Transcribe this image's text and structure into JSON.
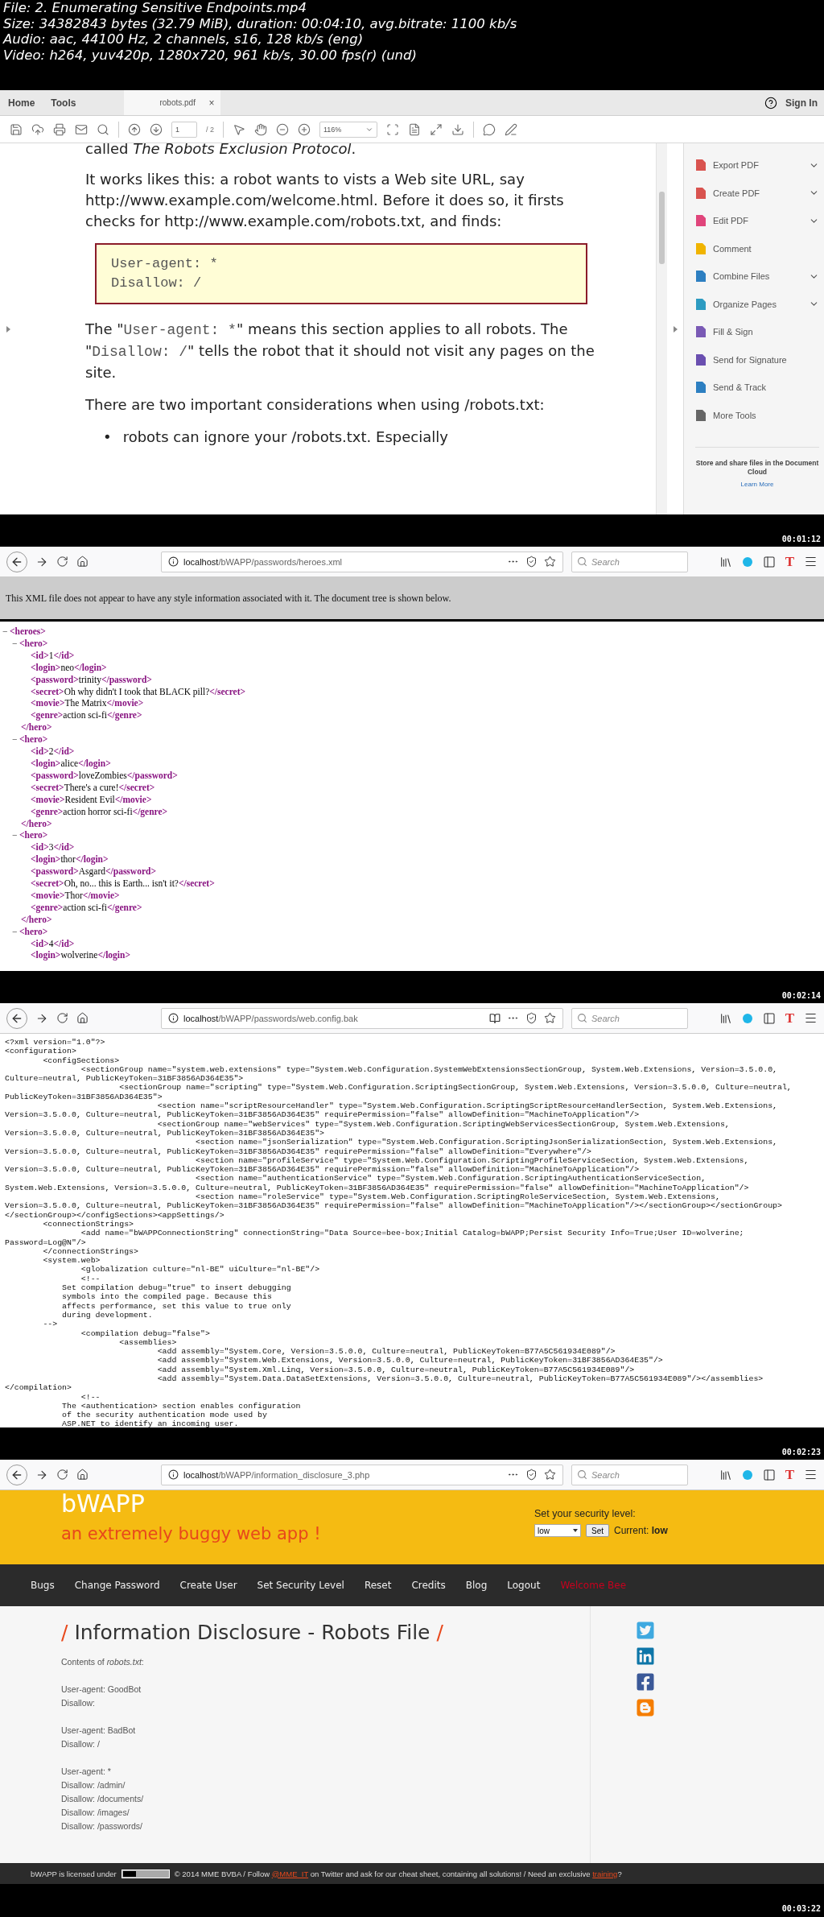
{
  "file_info": [
    "File: 2. Enumerating Sensitive Endpoints.mp4",
    "Size: 34382843 bytes (32.79 MiB), duration: 00:04:10, avg.bitrate: 1100 kb/s",
    "Audio: aac, 44100 Hz, 2 channels, s16, 128 kb/s (eng)",
    "Video: h264, yuv420p, 1280x720, 961 kb/s, 30.00 fps(r) (und)"
  ],
  "frames": [
    {
      "kind": "pdf",
      "timestamp": "00:01:12",
      "menu_tabs": [
        "Home",
        "Tools"
      ],
      "doc_tab": "robots.pdf",
      "close": "×",
      "sign_in": "Sign In",
      "page": "1",
      "page_total": "/ 2",
      "zoom": "116%",
      "top_line": "called *The Robots Exclusion Protocol*.",
      "intro": "It works likes this: a robot wants to vists a Web site URL, say http://www.example.com/welcome.html. Before it does so, it firsts checks for http://www.example.com/robots.txt, and finds:",
      "code_lines": [
        "User-agent: *",
        "Disallow: /"
      ],
      "explain": [
        {
          "kind": "text",
          "text": "The \""
        },
        {
          "kind": "code",
          "text": "User-agent: *"
        },
        {
          "kind": "text",
          "text": "\" means this section applies to all robots. The \""
        },
        {
          "kind": "code",
          "text": "Disallow: /"
        },
        {
          "kind": "text",
          "text": "\" tells the robot that it should not visit any pages on the site."
        }
      ],
      "considerations": "There are two important considerations when using /robots.txt:",
      "bullet": {
        "mark": "•",
        "text": "robots can ignore your /robots.txt. Especially"
      },
      "tools": [
        {
          "label": "Export PDF",
          "has_menu": true,
          "color": "#d9534f"
        },
        {
          "label": "Create PDF",
          "has_menu": true,
          "color": "#d9534f"
        },
        {
          "label": "Edit PDF",
          "has_menu": true,
          "color": "#e0457b"
        },
        {
          "label": "Comment",
          "has_menu": false,
          "color": "#f0b400"
        },
        {
          "label": "Combine Files",
          "has_menu": true,
          "color": "#2d7fc1"
        },
        {
          "label": "Organize Pages",
          "has_menu": true,
          "color": "#2d9bc1"
        },
        {
          "label": "Fill & Sign",
          "has_menu": false,
          "color": "#7a5ab5"
        },
        {
          "label": "Send for Signature",
          "has_menu": false,
          "color": "#6a4fb0"
        },
        {
          "label": "Send & Track",
          "has_menu": false,
          "color": "#2d7fc1"
        },
        {
          "label": "More Tools",
          "has_menu": false,
          "color": "#666666"
        }
      ],
      "cloud_text": "Store and share files in the Document Cloud",
      "learn_more": "Learn More"
    },
    {
      "kind": "xml",
      "timestamp": "00:02:14",
      "browser": {
        "url_host": "localhost",
        "url_path": "/bWAPP/passwords/heroes.xml",
        "search_placeholder": "Search",
        "reader_view": false,
        "extension_letter": "T"
      },
      "notice": "This XML file does not appear to have any style information associated with it. The document tree is shown below.",
      "tree": {
        "toggle": "−",
        "open": "<heroes>",
        "children": [
          {
            "toggle": "−",
            "open": "<hero>",
            "close": "</hero>",
            "fields": [
              {
                "open": "<id>",
                "value": "1",
                "close": "</id>"
              },
              {
                "open": "<login>",
                "value": "neo",
                "close": "</login>"
              },
              {
                "open": "<password>",
                "value": "trinity",
                "close": "</password>"
              },
              {
                "open": "<secret>",
                "value": "Oh why didn't I took that BLACK pill?",
                "close": "</secret>"
              },
              {
                "open": "<movie>",
                "value": "The Matrix",
                "close": "</movie>"
              },
              {
                "open": "<genre>",
                "value": "action sci-fi",
                "close": "</genre>"
              }
            ]
          },
          {
            "toggle": "−",
            "open": "<hero>",
            "close": "</hero>",
            "fields": [
              {
                "open": "<id>",
                "value": "2",
                "close": "</id>"
              },
              {
                "open": "<login>",
                "value": "alice",
                "close": "</login>"
              },
              {
                "open": "<password>",
                "value": "loveZombies",
                "close": "</password>"
              },
              {
                "open": "<secret>",
                "value": "There's a cure!",
                "close": "</secret>"
              },
              {
                "open": "<movie>",
                "value": "Resident Evil",
                "close": "</movie>"
              },
              {
                "open": "<genre>",
                "value": "action horror sci-fi",
                "close": "</genre>"
              }
            ]
          },
          {
            "toggle": "−",
            "open": "<hero>",
            "close": "</hero>",
            "fields": [
              {
                "open": "<id>",
                "value": "3",
                "close": "</id>"
              },
              {
                "open": "<login>",
                "value": "thor",
                "close": "</login>"
              },
              {
                "open": "<password>",
                "value": "Asgard",
                "close": "</password>"
              },
              {
                "open": "<secret>",
                "value": "Oh, no... this is Earth... isn't it?",
                "close": "</secret>"
              },
              {
                "open": "<movie>",
                "value": "Thor",
                "close": "</movie>"
              },
              {
                "open": "<genre>",
                "value": "action sci-fi",
                "close": "</genre>"
              }
            ]
          },
          {
            "toggle": "−",
            "open": "<hero>",
            "fields": [
              {
                "open": "<id>",
                "value": "4",
                "close": "</id>"
              },
              {
                "open": "<login>",
                "value": "wolverine",
                "close": "</login>"
              }
            ]
          }
        ]
      }
    },
    {
      "kind": "source",
      "timestamp": "00:02:23",
      "browser": {
        "url_host": "localhost",
        "url_path": "/bWAPP/passwords/web.config.bak",
        "search_placeholder": "Search",
        "reader_view": true,
        "extension_letter": "T"
      },
      "lines": [
        "<?xml version=\"1.0\"?>",
        "<configuration>",
        "        <configSections>",
        "                <sectionGroup name=\"system.web.extensions\" type=\"System.Web.Configuration.SystemWebExtensionsSectionGroup, System.Web.Extensions, Version=3.5.0.0,",
        "Culture=neutral, PublicKeyToken=31BF3856AD364E35\">",
        "                        <sectionGroup name=\"scripting\" type=\"System.Web.Configuration.ScriptingSectionGroup, System.Web.Extensions, Version=3.5.0.0, Culture=neutral,",
        "PublicKeyToken=31BF3856AD364E35\">",
        "                                <section name=\"scriptResourceHandler\" type=\"System.Web.Configuration.ScriptingScriptResourceHandlerSection, System.Web.Extensions,",
        "Version=3.5.0.0, Culture=neutral, PublicKeyToken=31BF3856AD364E35\" requirePermission=\"false\" allowDefinition=\"MachineToApplication\"/>",
        "                                <sectionGroup name=\"webServices\" type=\"System.Web.Configuration.ScriptingWebServicesSectionGroup, System.Web.Extensions,",
        "Version=3.5.0.0, Culture=neutral, PublicKeyToken=31BF3856AD364E35\">",
        "                                        <section name=\"jsonSerialization\" type=\"System.Web.Configuration.ScriptingJsonSerializationSection, System.Web.Extensions,",
        "Version=3.5.0.0, Culture=neutral, PublicKeyToken=31BF3856AD364E35\" requirePermission=\"false\" allowDefinition=\"Everywhere\"/>",
        "                                        <section name=\"profileService\" type=\"System.Web.Configuration.ScriptingProfileServiceSection, System.Web.Extensions,",
        "Version=3.5.0.0, Culture=neutral, PublicKeyToken=31BF3856AD364E35\" requirePermission=\"false\" allowDefinition=\"MachineToApplication\"/>",
        "                                        <section name=\"authenticationService\" type=\"System.Web.Configuration.ScriptingAuthenticationServiceSection,",
        "System.Web.Extensions, Version=3.5.0.0, Culture=neutral, PublicKeyToken=31BF3856AD364E35\" requirePermission=\"false\" allowDefinition=\"MachineToApplication\"/>",
        "                                        <section name=\"roleService\" type=\"System.Web.Configuration.ScriptingRoleServiceSection, System.Web.Extensions,",
        "Version=3.5.0.0, Culture=neutral, PublicKeyToken=31BF3856AD364E35\" requirePermission=\"false\" allowDefinition=\"MachineToApplication\"/></sectionGroup></sectionGroup>",
        "</sectionGroup></configSections><appSettings/>",
        "        <connectionStrings>",
        "                <add name=\"bWAPPConnectionString\" connectionString=\"Data Source=bee-box;Initial Catalog=bWAPP;Persist Security Info=True;User ID=wolverine;",
        "Password=Log@N\"/>",
        "        </connectionStrings>",
        "        <system.web>",
        "                <globalization culture=\"nl-BE\" uiCulture=\"nl-BE\"/>",
        "                <!--",
        "            Set compilation debug=\"true\" to insert debugging",
        "            symbols into the compiled page. Because this",
        "            affects performance, set this value to true only",
        "            during development.",
        "        -->",
        "                <compilation debug=\"false\">",
        "                        <assemblies>",
        "                                <add assembly=\"System.Core, Version=3.5.0.0, Culture=neutral, PublicKeyToken=B77A5C561934E089\"/>",
        "                                <add assembly=\"System.Web.Extensions, Version=3.5.0.0, Culture=neutral, PublicKeyToken=31BF3856AD364E35\"/>",
        "                                <add assembly=\"System.Xml.Linq, Version=3.5.0.0, Culture=neutral, PublicKeyToken=B77A5C561934E089\"/>",
        "                                <add assembly=\"System.Data.DataSetExtensions, Version=3.5.0.0, Culture=neutral, PublicKeyToken=B77A5C561934E089\"/></assemblies>",
        "</compilation>",
        "                <!--",
        "            The <authentication> section enables configuration",
        "            of the security authentication mode used by",
        "            ASP.NET to identify an incoming user."
      ]
    },
    {
      "kind": "bwapp",
      "timestamp": "00:03:22",
      "browser": {
        "url_host": "localhost",
        "url_path": "/bWAPP/information_disclosure_3.php",
        "search_placeholder": "Search",
        "reader_view": false,
        "extension_letter": "T"
      },
      "logo": "bWAPP",
      "tagline": "an extremely buggy web app !",
      "security": {
        "label": "Set your security level:",
        "select_value": "low",
        "button": "Set",
        "current_label": "Current:",
        "current_value": "low"
      },
      "nav": [
        "Bugs",
        "Change Password",
        "Create User",
        "Set Security Level",
        "Reset",
        "Credits",
        "Blog",
        "Logout"
      ],
      "welcome": "Welcome Bee",
      "title": {
        "slash_left": "/",
        "text": "Information Disclosure - Robots File",
        "slash_right": "/"
      },
      "contents_label": "Contents of *robots.txt*:",
      "robots_blocks": [
        [
          "User-agent: GoodBot",
          "Disallow:"
        ],
        [
          "User-agent: BadBot",
          "Disallow: /"
        ],
        [
          "User-agent: *",
          "Disallow: /admin/",
          "Disallow: /documents/",
          "Disallow: /images/",
          "Disallow: /passwords/"
        ]
      ],
      "social": [
        {
          "kind": "twitter"
        },
        {
          "kind": "linkedin"
        },
        {
          "kind": "facebook"
        },
        {
          "kind": "blogger"
        }
      ],
      "footer": {
        "before": "bWAPP is licensed under",
        "parts": [
          {
            "kind": "text",
            "text": "© 2014 MME BVBA / Follow "
          },
          {
            "kind": "link",
            "text": "@MME_IT"
          },
          {
            "kind": "text",
            "text": " on Twitter and ask for our cheat sheet, containing all solutions! / Need an exclusive "
          },
          {
            "kind": "link",
            "text": "training"
          },
          {
            "kind": "text",
            "text": "?"
          }
        ]
      }
    }
  ]
}
